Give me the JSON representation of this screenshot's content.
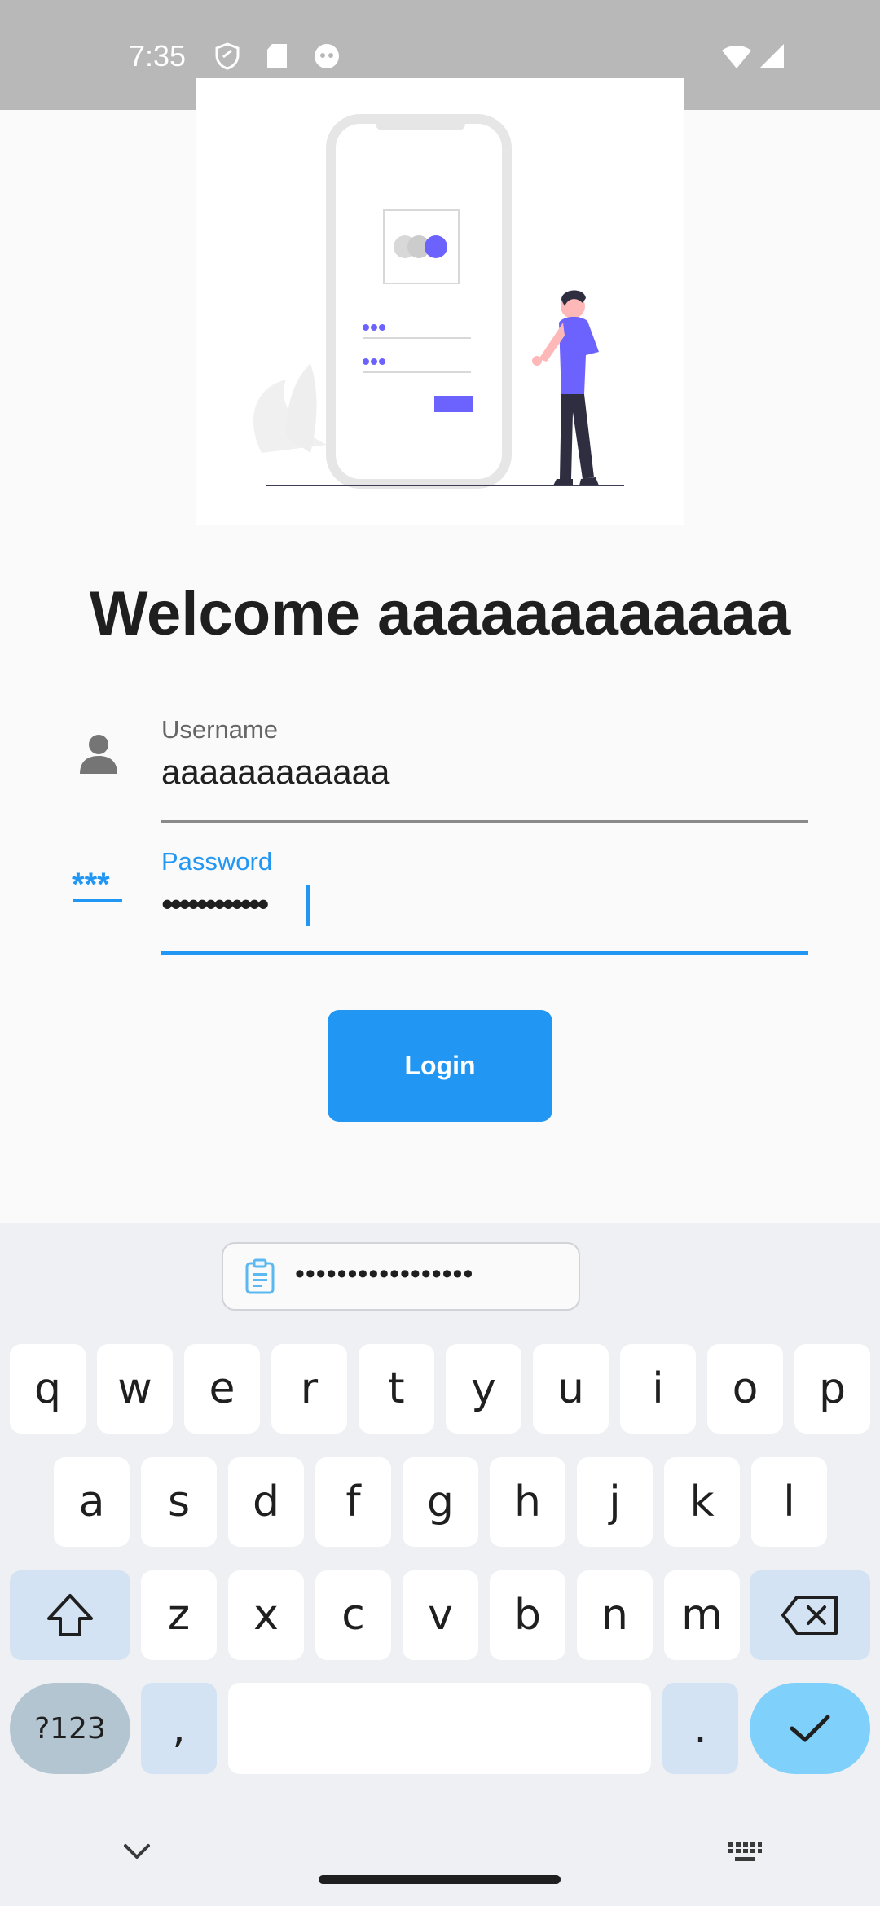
{
  "status_bar": {
    "time": "7:35"
  },
  "welcome_title": "Welcome aaaaaaaaaaaa",
  "username": {
    "label": "Username",
    "value": "aaaaaaaaaaaa"
  },
  "password": {
    "label": "Password",
    "value": "••••••••••••",
    "icon_text": "***"
  },
  "login_button": {
    "label": "Login"
  },
  "keyboard": {
    "suggestion": "•••••••••••••••••",
    "row1": [
      "q",
      "w",
      "e",
      "r",
      "t",
      "y",
      "u",
      "i",
      "o",
      "p"
    ],
    "row2": [
      "a",
      "s",
      "d",
      "f",
      "g",
      "h",
      "j",
      "k",
      "l"
    ],
    "row3": [
      "z",
      "x",
      "c",
      "v",
      "b",
      "n",
      "m"
    ],
    "symbols_key": "?123",
    "comma_key": ",",
    "period_key": "."
  },
  "colors": {
    "accent": "#2196f3",
    "illustration": "#6c63ff",
    "enter_key": "#7fd0fb"
  }
}
